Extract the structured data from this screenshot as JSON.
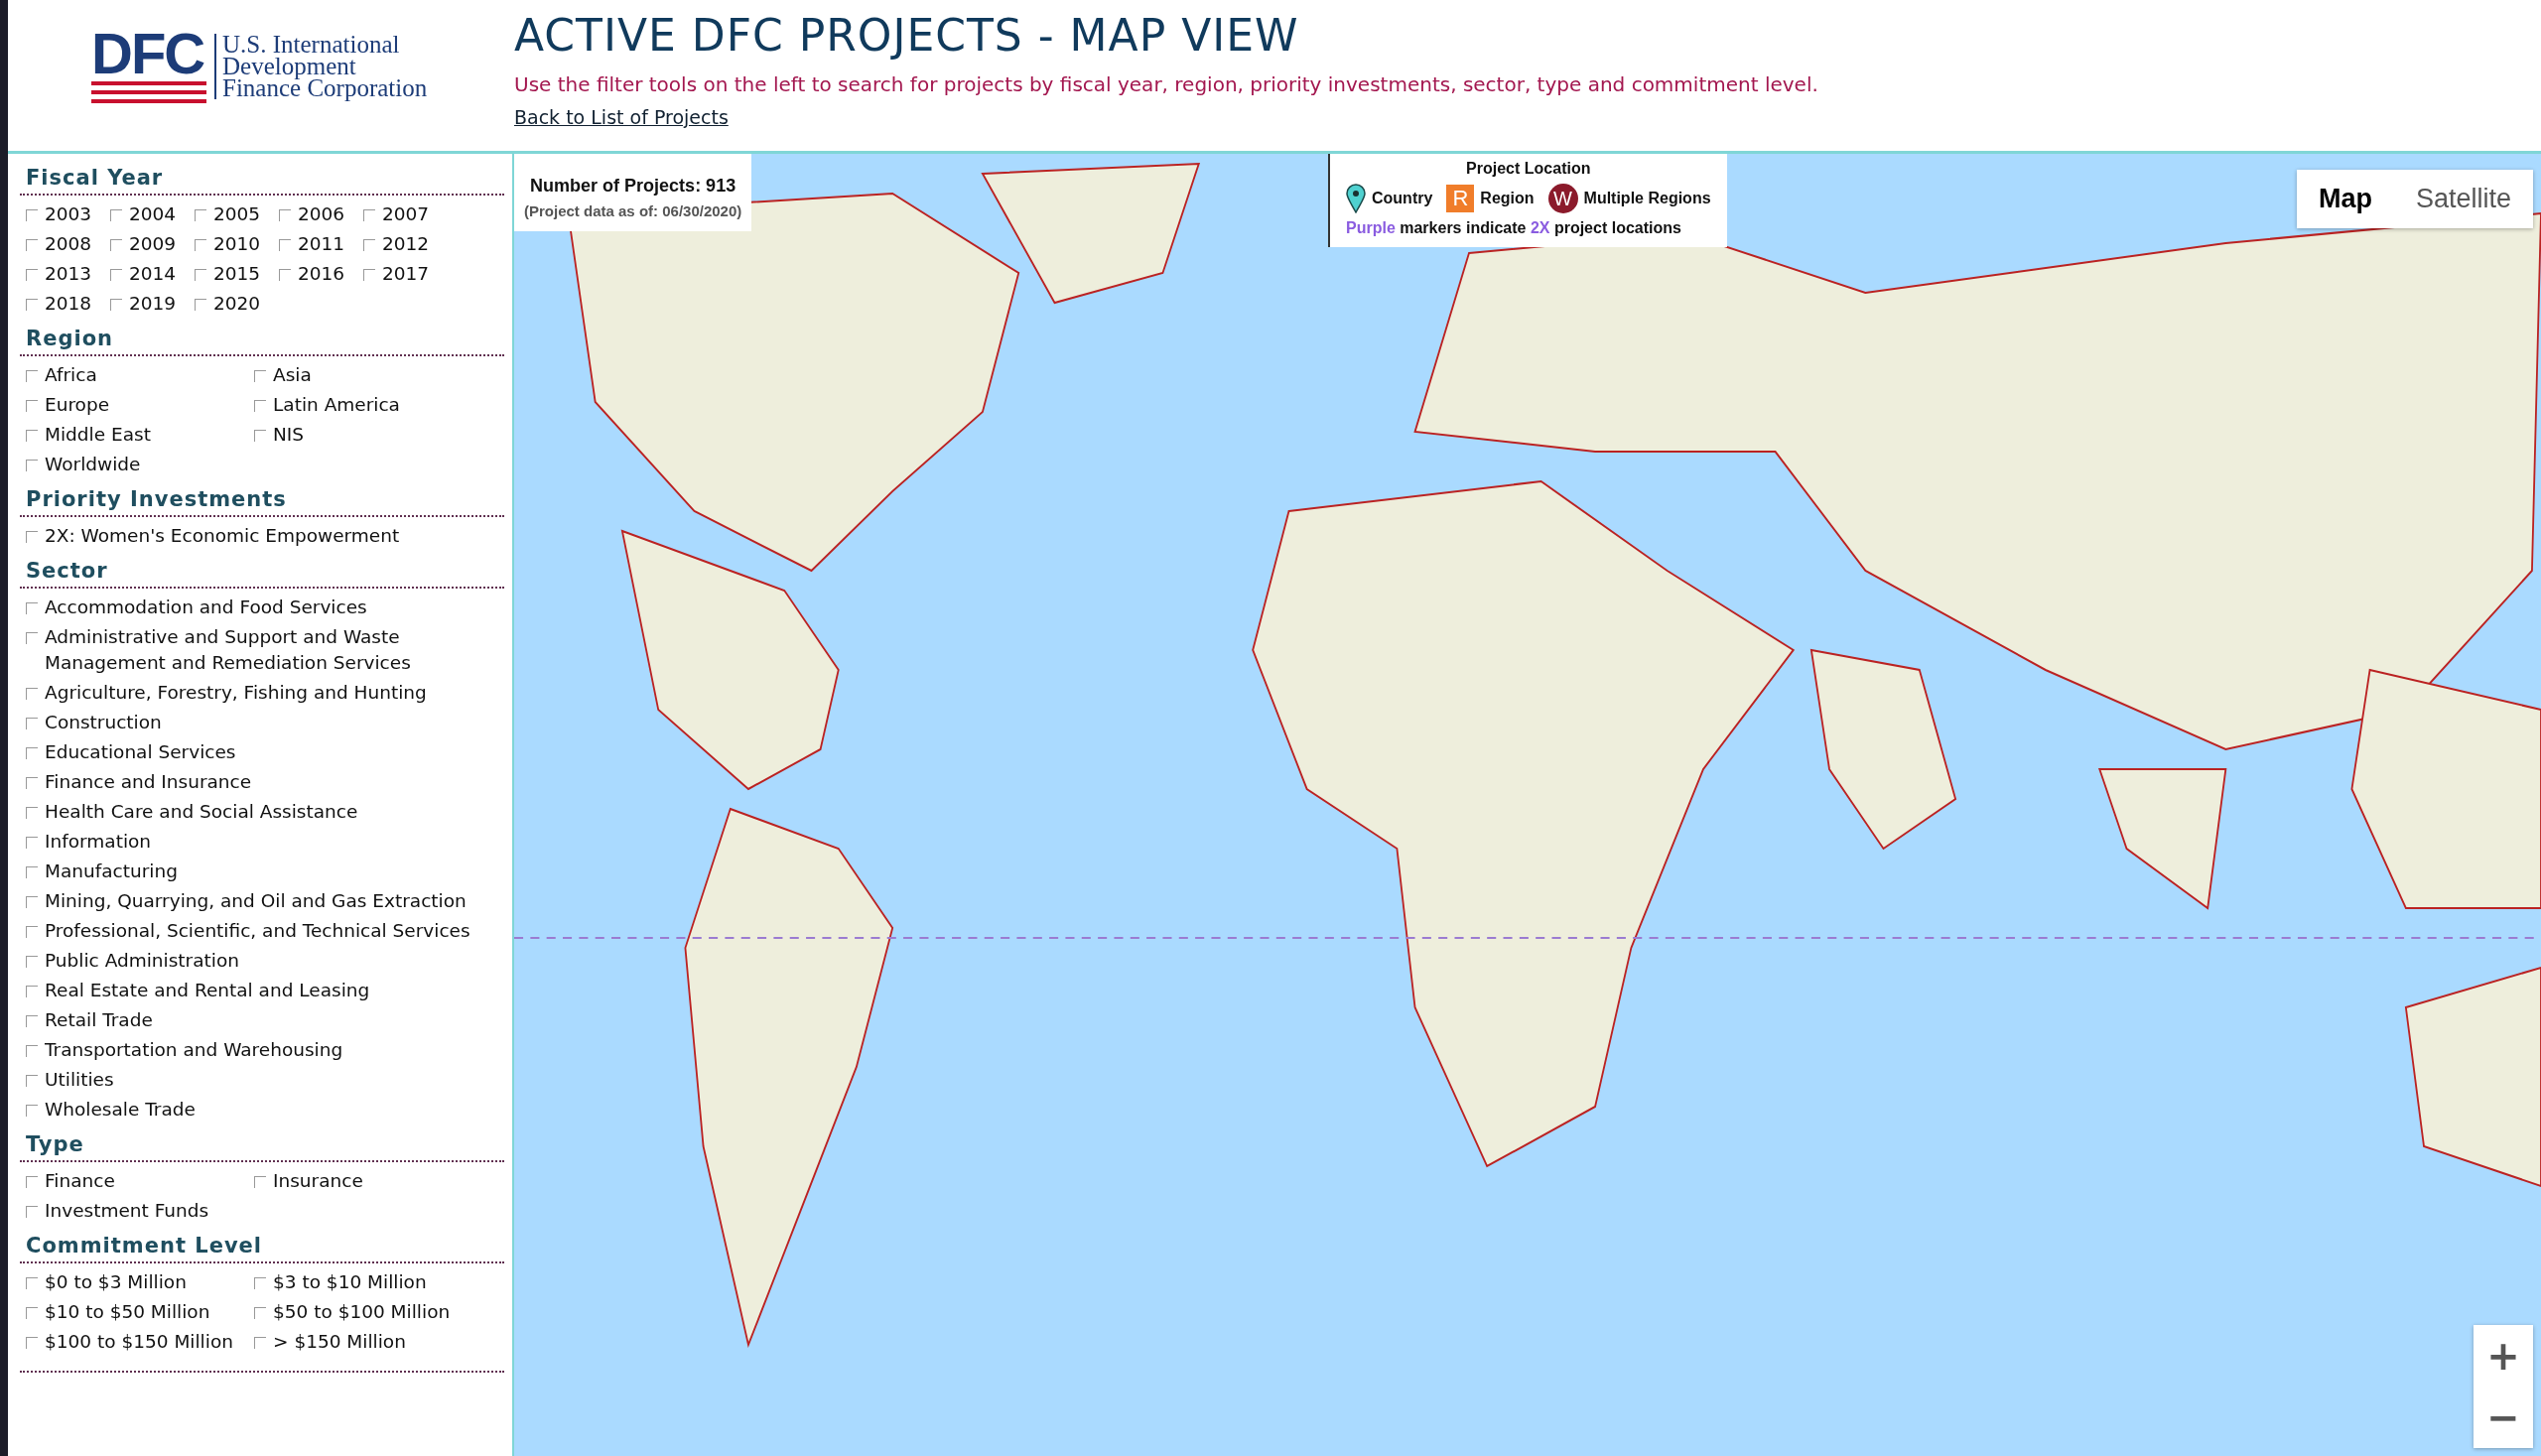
{
  "logo": {
    "mark": "DFC",
    "lines": [
      "U.S. International",
      "Development",
      "Finance Corporation"
    ]
  },
  "header": {
    "title": "ACTIVE DFC PROJECTS - MAP VIEW",
    "subtitle": "Use the filter tools on the left to search for projects by fiscal year, region, priority investments, sector, type and commitment level.",
    "link": "Back to List of Projects"
  },
  "filters": [
    {
      "title": "Fiscal Year",
      "kind": "grid",
      "options": [
        {
          "label": "2003",
          "checked": false
        },
        {
          "label": "2004",
          "checked": false
        },
        {
          "label": "2005",
          "checked": false
        },
        {
          "label": "2006",
          "checked": false
        },
        {
          "label": "2007",
          "checked": false
        },
        {
          "label": "2008",
          "checked": false
        },
        {
          "label": "2009",
          "checked": false
        },
        {
          "label": "2010",
          "checked": false
        },
        {
          "label": "2011",
          "checked": false
        },
        {
          "label": "2012",
          "checked": false
        },
        {
          "label": "2013",
          "checked": false
        },
        {
          "label": "2014",
          "checked": false
        },
        {
          "label": "2015",
          "checked": false
        },
        {
          "label": "2016",
          "checked": false
        },
        {
          "label": "2017",
          "checked": false
        },
        {
          "label": "2018",
          "checked": false
        },
        {
          "label": "2019",
          "checked": false
        },
        {
          "label": "2020",
          "checked": false
        }
      ]
    },
    {
      "title": "Region",
      "kind": "pairs",
      "options": [
        {
          "label": "Africa",
          "checked": false
        },
        {
          "label": "Asia",
          "checked": false
        },
        {
          "label": "Europe",
          "checked": false
        },
        {
          "label": "Latin America",
          "checked": false
        },
        {
          "label": "Middle East",
          "checked": false
        },
        {
          "label": "NIS",
          "checked": false
        },
        {
          "label": "Worldwide",
          "checked": false
        }
      ]
    },
    {
      "title": "Priority Investments",
      "kind": "list",
      "options": [
        {
          "label": "2X: Women's Economic Empowerment",
          "checked": false
        }
      ]
    },
    {
      "title": "Sector",
      "kind": "list",
      "options": [
        {
          "label": "Accommodation and Food Services",
          "checked": false
        },
        {
          "label": "Administrative and Support and Waste Management and Remediation Services",
          "checked": false
        },
        {
          "label": "Agriculture, Forestry, Fishing and Hunting",
          "checked": false
        },
        {
          "label": "Construction",
          "checked": false
        },
        {
          "label": "Educational Services",
          "checked": false
        },
        {
          "label": "Finance and Insurance",
          "checked": false
        },
        {
          "label": "Health Care and Social Assistance",
          "checked": false
        },
        {
          "label": "Information",
          "checked": false
        },
        {
          "label": "Manufacturing",
          "checked": false
        },
        {
          "label": "Mining, Quarrying, and Oil and Gas Extraction",
          "checked": false
        },
        {
          "label": "Professional, Scientific, and Technical Services",
          "checked": false
        },
        {
          "label": "Public Administration",
          "checked": false
        },
        {
          "label": "Real Estate and Rental and Leasing",
          "checked": false
        },
        {
          "label": "Retail Trade",
          "checked": false
        },
        {
          "label": "Transportation and Warehousing",
          "checked": false
        },
        {
          "label": "Utilities",
          "checked": false
        },
        {
          "label": "Wholesale Trade",
          "checked": false
        }
      ]
    },
    {
      "title": "Type",
      "kind": "pairs",
      "options": [
        {
          "label": "Finance",
          "checked": false
        },
        {
          "label": "Insurance",
          "checked": false
        },
        {
          "label": "Investment Funds",
          "checked": false
        }
      ]
    },
    {
      "title": "Commitment Level",
      "kind": "pairs",
      "options": [
        {
          "label": "$0 to $3 Million",
          "checked": false
        },
        {
          "label": "$3 to $10 Million",
          "checked": false
        },
        {
          "label": "$10 to $50 Million",
          "checked": false
        },
        {
          "label": "$50 to $100 Million",
          "checked": false
        },
        {
          "label": "$100 to $150 Million",
          "checked": false
        },
        {
          "label": "> $150 Million",
          "checked": false
        }
      ]
    }
  ],
  "map": {
    "kind": "picture",
    "count": {
      "title": "Number of Projects: 913",
      "note": "(Project data as of: 06/30/2020)"
    },
    "legend": {
      "title": "Project Location",
      "items": [
        {
          "kind": "pin",
          "label": "Country"
        },
        {
          "kind": "square",
          "glyph": "R",
          "label": "Region"
        },
        {
          "kind": "circle",
          "glyph": "W",
          "label": "Multiple Regions"
        }
      ],
      "note": [
        {
          "text": "Purple",
          "highlight": true
        },
        {
          "text": " markers indicate ",
          "highlight": false
        },
        {
          "text": "2X",
          "highlight": true
        },
        {
          "text": " project locations",
          "highlight": false
        }
      ]
    },
    "view_tabs": [
      {
        "label": "Map",
        "selected": true
      },
      {
        "label": "Satellite",
        "selected": false
      }
    ],
    "zoom": [
      "+",
      "−"
    ]
  }
}
